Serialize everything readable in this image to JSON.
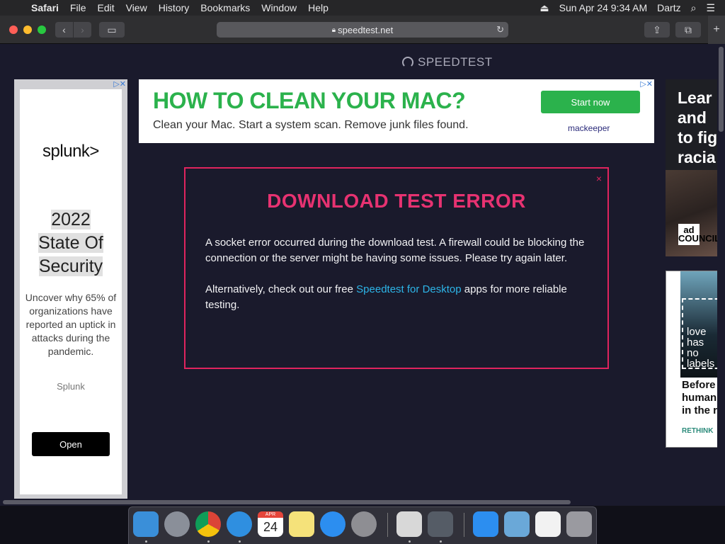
{
  "menubar": {
    "app_name": "Safari",
    "items": [
      "File",
      "Edit",
      "View",
      "History",
      "Bookmarks",
      "Window",
      "Help"
    ],
    "datetime": "Sun Apr 24  9:34 AM",
    "user": "Dartz"
  },
  "toolbar": {
    "url": "speedtest.net"
  },
  "page": {
    "logo_text": "SPEEDTEST",
    "ads": {
      "left": {
        "adchoice": "▷✕",
        "logo": "splunk>",
        "headline": [
          "2022",
          "State Of",
          "Security"
        ],
        "body": "Uncover why 65% of organizations have reported an uptick in attacks during the pandemic.",
        "brand": "Splunk",
        "cta": "Open"
      },
      "top": {
        "adchoice": "▷✕",
        "headline": "HOW TO CLEAN YOUR MAC?",
        "subtext": "Clean your Mac. Start a system scan. Remove junk files found.",
        "cta": "Start now",
        "logo": "mackeeper"
      },
      "right1": {
        "text": "Lear\nand\nto fig\nracia",
        "badge": "ad\nCOUNCIL"
      },
      "right2": {
        "box_text": "love\nhas\nno\nlabels",
        "text": "Before\nhuman\nin the r",
        "footer": "RETHINK"
      }
    },
    "modal": {
      "close": "×",
      "title": "DOWNLOAD TEST ERROR",
      "paragraph1": "A socket error occurred during the download test. A firewall could be blocking the connection or the server might be having some issues. Please try again later.",
      "paragraph2_prefix": "Alternatively, check out our free ",
      "paragraph2_link": "Speedtest for Desktop",
      "paragraph2_suffix": " apps for more reliable testing."
    }
  },
  "dock": {
    "calendar_month": "APR",
    "calendar_day": "24",
    "apps": [
      {
        "name": "finder-icon",
        "color": "#3a8fd9"
      },
      {
        "name": "launchpad-icon",
        "color": "#8a8f99"
      },
      {
        "name": "chrome-icon",
        "color": "#e8e8e8"
      },
      {
        "name": "safari-icon",
        "color": "#2f8fe0"
      },
      {
        "name": "calendar-icon",
        "color": "#ffffff"
      },
      {
        "name": "notes-icon",
        "color": "#f5e27a"
      },
      {
        "name": "app-store-icon",
        "color": "#2c8ef0"
      },
      {
        "name": "system-preferences-icon",
        "color": "#8e8e93"
      },
      {
        "name": "script-editor-icon",
        "color": "#d8d8d8"
      },
      {
        "name": "utilities-icon",
        "color": "#555c66"
      },
      {
        "name": "app-store-folder-icon",
        "color": "#2c8ef0"
      },
      {
        "name": "downloads-folder-icon",
        "color": "#6aa8d8"
      },
      {
        "name": "document-icon",
        "color": "#f2f2f2"
      },
      {
        "name": "trash-icon",
        "color": "#9a9aa0"
      }
    ]
  }
}
